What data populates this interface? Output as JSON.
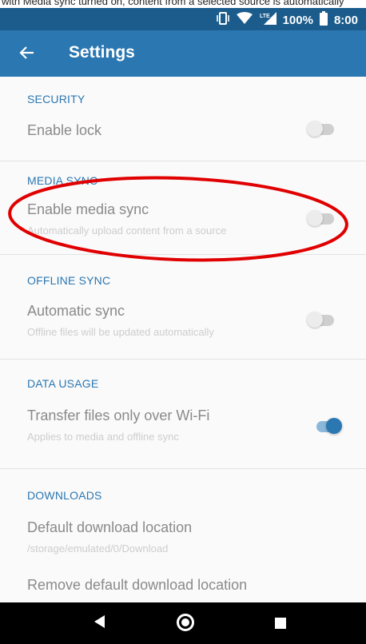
{
  "top_strip_text": "with Media sync turned on, content from a selected source is automatically",
  "status_bar": {
    "battery_pct": "100%",
    "time": "8:00",
    "network": "LTE"
  },
  "app_bar": {
    "title": "Settings"
  },
  "sections": {
    "security": {
      "header": "SECURITY",
      "enable_lock": {
        "title": "Enable lock",
        "on": false
      }
    },
    "media_sync": {
      "header": "MEDIA SYNC",
      "enable_media_sync": {
        "title": "Enable media sync",
        "summary": "Automatically upload content from a source",
        "on": false
      }
    },
    "offline_sync": {
      "header": "OFFLINE SYNC",
      "automatic_sync": {
        "title": "Automatic sync",
        "summary": "Offline files will be updated automatically",
        "on": false
      }
    },
    "data_usage": {
      "header": "DATA USAGE",
      "wifi_only": {
        "title": "Transfer files only over Wi-Fi",
        "summary": "Applies to media and offline sync",
        "on": true
      }
    },
    "downloads": {
      "header": "DOWNLOADS",
      "default_location": {
        "title": "Default download location",
        "summary": "/storage/emulated/0/Download"
      },
      "remove_default": {
        "title": "Remove default download location"
      }
    }
  },
  "annotation_color": "#e00000"
}
